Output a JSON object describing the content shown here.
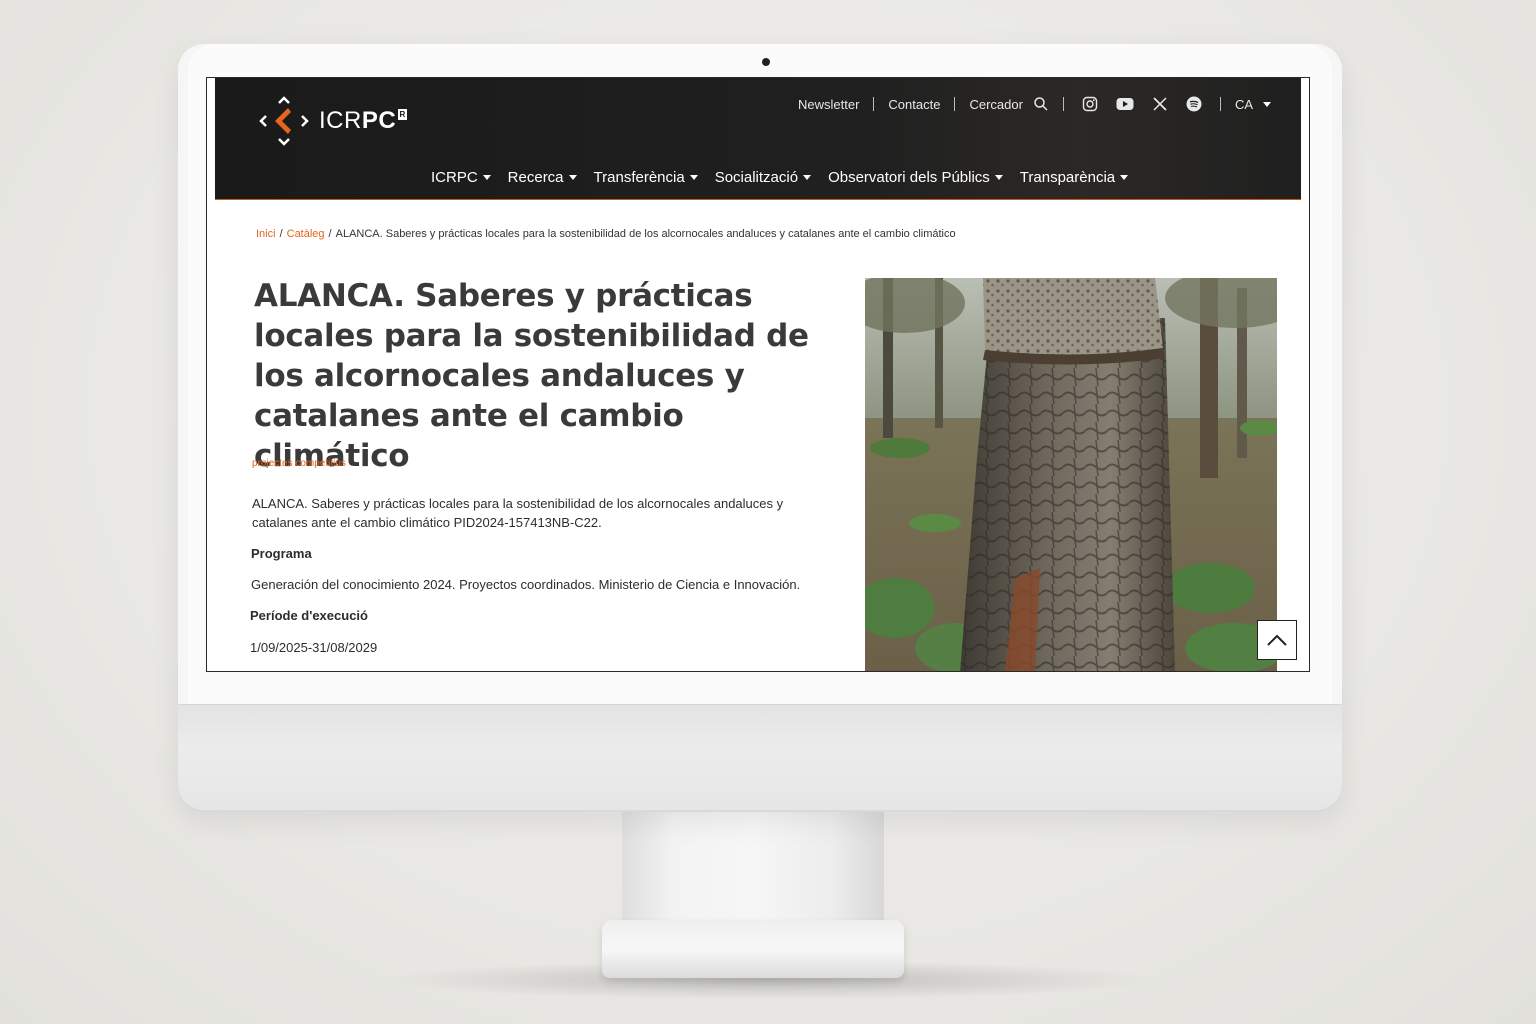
{
  "header": {
    "logo_text_light": "ICR",
    "logo_text_bold": "PC",
    "logo_badge": "R",
    "top_links": {
      "newsletter": "Newsletter",
      "contact": "Contacte",
      "search": "Cercador",
      "language": "CA"
    },
    "social_icons": [
      "instagram-icon",
      "youtube-icon",
      "x-icon",
      "spotify-icon"
    ],
    "nav": [
      "ICRPC",
      "Recerca",
      "Transferència",
      "Socialització",
      "Observatori dels Públics",
      "Transparència"
    ]
  },
  "breadcrumb": {
    "home": "Inici",
    "catalog": "Catàleg",
    "current": "ALANCA. Saberes y prácticas locales para la sostenibilidad de los alcornocales andaluces y catalanes ante el cambio climático"
  },
  "page": {
    "title": "ALANCA. Saberes y prácticas locales para la sostenibilidad de los alcornocales andaluces y catalanes ante el cambio climático",
    "tag": "projectes competitius",
    "description": "ALANCA. Saberes y prácticas locales para la sostenibilidad de los alcornocales andaluces y catalanes ante el cambio climático PID2024-157413NB-C22.",
    "program_label": "Programa",
    "program_value": "Generación del conocimiento 2024. Proyectos coordinados. Ministerio de Ciencia e Innovación.",
    "period_label": "Període d'execució",
    "period_value": "1/09/2025-31/08/2029"
  },
  "colors": {
    "accent": "#e0651e",
    "header_bg": "#1a1a1a",
    "text": "#2d2d2d"
  }
}
